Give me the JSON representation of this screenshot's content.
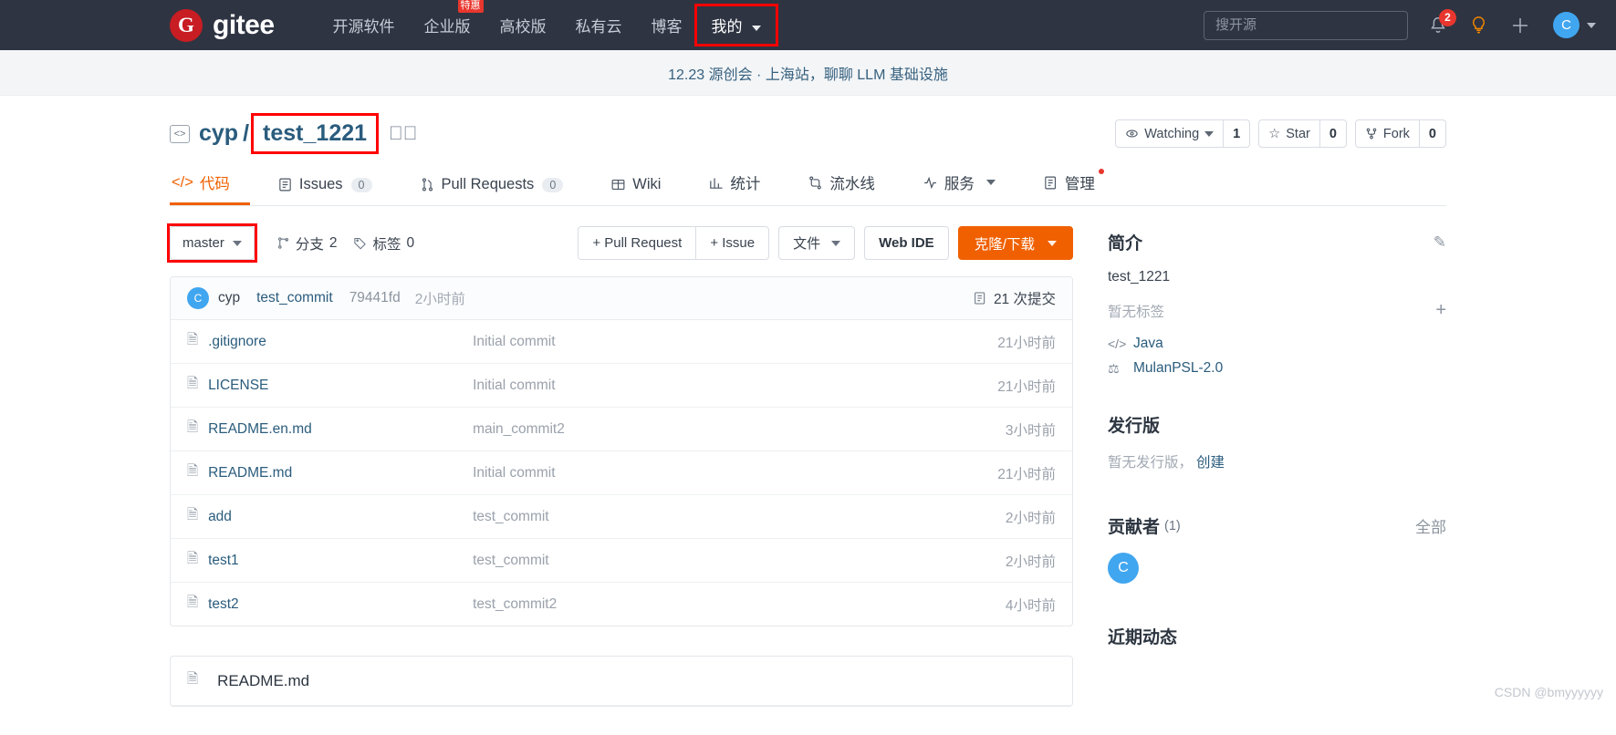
{
  "header": {
    "logo_letter": "G",
    "logo_text": "gitee",
    "nav": [
      {
        "label": "开源软件",
        "badge": null,
        "dropdown": false,
        "highlighted": false
      },
      {
        "label": "企业版",
        "badge": "特惠",
        "dropdown": false,
        "highlighted": false
      },
      {
        "label": "高校版",
        "badge": null,
        "dropdown": false,
        "highlighted": false
      },
      {
        "label": "私有云",
        "badge": null,
        "dropdown": false,
        "highlighted": false
      },
      {
        "label": "博客",
        "badge": null,
        "dropdown": false,
        "highlighted": false
      },
      {
        "label": "我的",
        "badge": null,
        "dropdown": true,
        "highlighted": true
      }
    ],
    "search_placeholder": "搜开源",
    "notification_count": "2",
    "avatar_letter": "C",
    "accent_red": "#c71d23",
    "bg": "#2e3442"
  },
  "banner": {
    "text": "12.23 源创会 · 上海站，聊聊 LLM 基础设施"
  },
  "repo": {
    "owner": "cyp",
    "separator": "/",
    "name": "test_1221",
    "watching_label": "Watching",
    "watching_count": "1",
    "star_label": "Star",
    "star_count": "0",
    "fork_label": "Fork",
    "fork_count": "0"
  },
  "tabs": [
    {
      "label": "代码",
      "count": null,
      "active": true,
      "dropdown": false,
      "dot": false
    },
    {
      "label": "Issues",
      "count": "0",
      "active": false,
      "dropdown": false,
      "dot": false
    },
    {
      "label": "Pull Requests",
      "count": "0",
      "active": false,
      "dropdown": false,
      "dot": false
    },
    {
      "label": "Wiki",
      "count": null,
      "active": false,
      "dropdown": false,
      "dot": false
    },
    {
      "label": "统计",
      "count": null,
      "active": false,
      "dropdown": false,
      "dot": false
    },
    {
      "label": "流水线",
      "count": null,
      "active": false,
      "dropdown": false,
      "dot": false
    },
    {
      "label": "服务",
      "count": null,
      "active": false,
      "dropdown": true,
      "dot": false
    },
    {
      "label": "管理",
      "count": null,
      "active": false,
      "dropdown": false,
      "dot": true
    }
  ],
  "toolbar": {
    "branch": "master",
    "branches_label": "分支",
    "branches_count": "2",
    "tags_label": "标签",
    "tags_count": "0",
    "pull_request_btn": "+ Pull Request",
    "issue_btn": "+ Issue",
    "files_btn": "文件",
    "web_ide_btn": "Web IDE",
    "clone_btn": "克隆/下载",
    "primary_color": "#f06000"
  },
  "commit_bar": {
    "avatar_letter": "C",
    "author": "cyp",
    "message": "test_commit",
    "sha": "79441fd",
    "time": "2小时前",
    "commits_text": "21 次提交"
  },
  "files": [
    {
      "name": ".gitignore",
      "message": "Initial commit",
      "time": "21小时前"
    },
    {
      "name": "LICENSE",
      "message": "Initial commit",
      "time": "21小时前"
    },
    {
      "name": "README.en.md",
      "message": "main_commit2",
      "time": "3小时前"
    },
    {
      "name": "README.md",
      "message": "Initial commit",
      "time": "21小时前"
    },
    {
      "name": "add",
      "message": "test_commit",
      "time": "2小时前"
    },
    {
      "name": "test1",
      "message": "test_commit",
      "time": "2小时前"
    },
    {
      "name": "test2",
      "message": "test_commit2",
      "time": "4小时前"
    }
  ],
  "readme": {
    "title": "README.md"
  },
  "sidebar": {
    "intro_title": "简介",
    "intro_text": "test_1221",
    "no_tags": "暂无标签",
    "language": "Java",
    "license": "MulanPSL-2.0",
    "release_title": "发行版",
    "release_empty": "暂无发行版，",
    "release_create": "创建",
    "contributors_title": "贡献者",
    "contributors_count": "(1)",
    "contributors_all": "全部",
    "contributor_avatar": "C",
    "activity_title": "近期动态"
  },
  "watermark": "CSDN @bmyyyyyy"
}
